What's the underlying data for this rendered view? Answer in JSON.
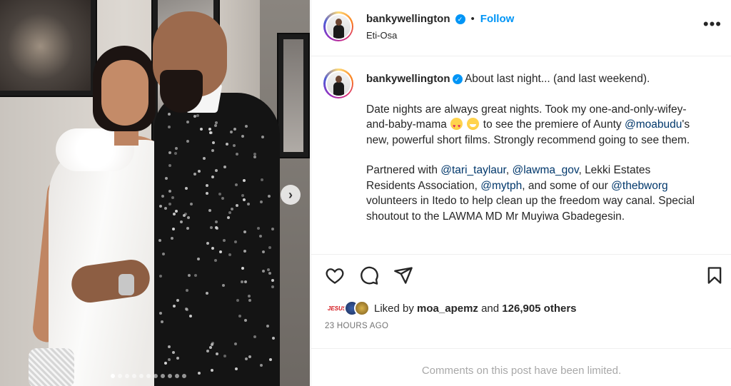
{
  "post": {
    "username": "bankywellington",
    "location": "Eti-Osa",
    "follow_label": "Follow",
    "separator": "•",
    "more_label": "•••",
    "verified_icon": "verified-badge-icon",
    "caption": {
      "line1_text": "About last night... (and last weekend).",
      "para2_part1": "Date nights are always great nights. Took my one-and-only-wifey-and-baby-mama",
      "emoji1": "heart-eyes-emoji",
      "emoji2": "grinning-emoji",
      "para2_part2": "to see the premiere of Aunty",
      "mention_moabudu": "@moabudu",
      "para2_part3": "'s new, powerful short films. Strongly recommend going to see them.",
      "para3_part1": "Partnered with",
      "mention_tari": "@tari_taylaur",
      "comma1": ",",
      "mention_lawma": "@lawma_gov",
      "para3_part2": ", Lekki Estates Residents Association,",
      "mention_mytph": "@mytph",
      "para3_part3": ", and some of our",
      "mention_thebworg": "@thebworg",
      "para3_part4": "volunteers in Itedo to help clean up the freedom way canal. Special shoutout to the LAWMA MD Mr Muyiwa Gbadegesin."
    },
    "likes": {
      "prefix": "Liked by",
      "user": "moa_apemz",
      "middle": "and",
      "count": "126,905 others",
      "avatar1_text": "JESUS"
    },
    "timestamp": "23 HOURS AGO",
    "comments_limited": "Comments on this post have been limited.",
    "carousel": {
      "total": 11,
      "active": 0,
      "next_icon": "›"
    }
  },
  "icons": {
    "like": "heart-icon",
    "comment": "comment-icon",
    "share": "paper-plane-icon",
    "save": "bookmark-icon"
  },
  "colors": {
    "accent": "#0095f6",
    "mention": "#00376b",
    "muted": "#737373"
  }
}
